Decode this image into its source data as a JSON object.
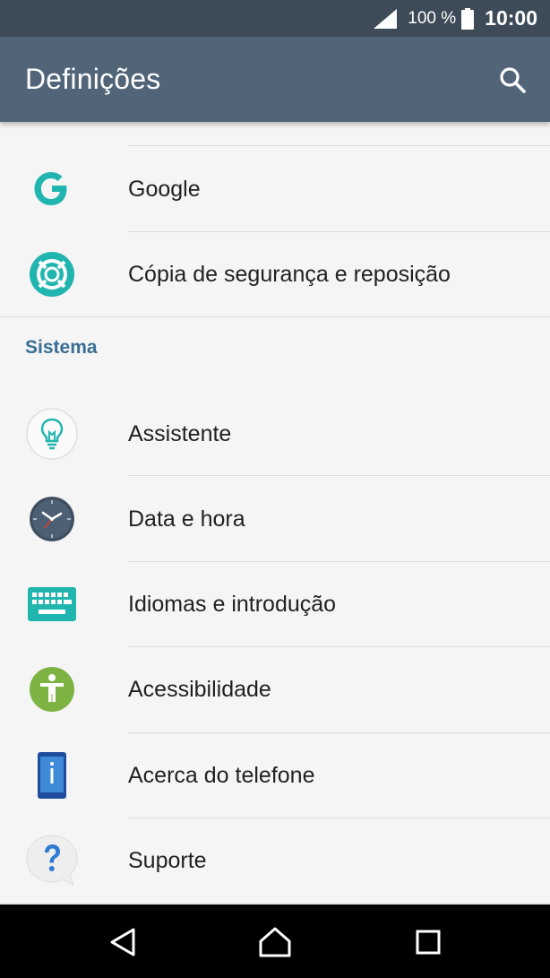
{
  "status_bar": {
    "battery_percent": "100 %",
    "time": "10:00"
  },
  "app_bar": {
    "title": "Definições"
  },
  "settings": {
    "items_top": [
      {
        "label": "Google",
        "icon": "google-icon"
      },
      {
        "label": "Cópia de segurança e reposição",
        "icon": "backup-reset-icon"
      }
    ],
    "section_system": "Sistema",
    "items_system": [
      {
        "label": "Assistente",
        "icon": "lightbulb-icon"
      },
      {
        "label": "Data e hora",
        "icon": "clock-icon"
      },
      {
        "label": "Idiomas e introdução",
        "icon": "keyboard-icon"
      },
      {
        "label": "Acessibilidade",
        "icon": "accessibility-icon"
      },
      {
        "label": "Acerca do telefone",
        "icon": "phone-info-icon"
      },
      {
        "label": "Suporte",
        "icon": "help-icon"
      }
    ]
  },
  "colors": {
    "status_bar": "#3d4a57",
    "app_bar": "#526578",
    "accent": "#3a6f94",
    "teal": "#21b5b0"
  }
}
